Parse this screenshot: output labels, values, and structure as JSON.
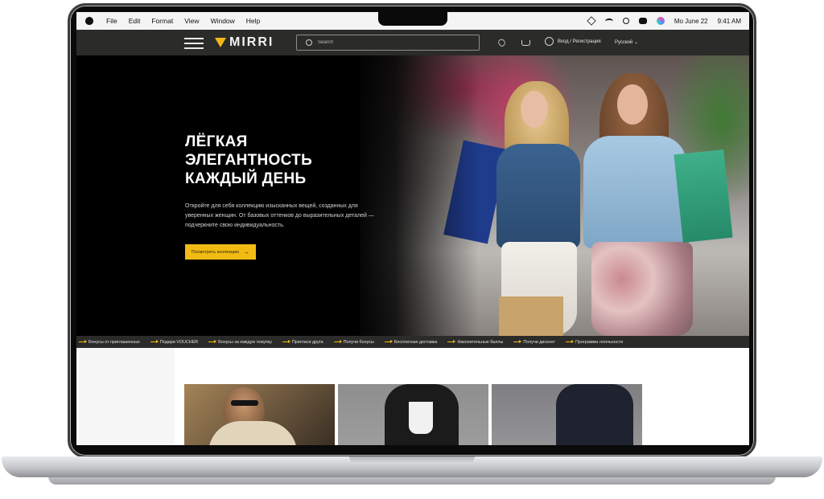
{
  "menubar": {
    "items": [
      "File",
      "Edit",
      "Format",
      "View",
      "Window",
      "Help"
    ],
    "date": "Mo June 22",
    "time": "9:41 AM"
  },
  "header": {
    "logo_text": "MIRRI",
    "search_placeholder": "Search",
    "login_label": "Вход / Регистрация",
    "language": "Русский",
    "language_caret": "⌄"
  },
  "hero": {
    "title_lines": [
      "ЛЁГКАЯ",
      "ЭЛЕГАНТНОСТЬ",
      "КАЖДЫЙ ДЕНЬ"
    ],
    "text": "Откройте для себя коллекцию изысканных вещей, созданных для уверенных женщин. От базовых оттенков до выразительных деталей — подчеркните свою индивидуальность.",
    "cta_label": "Посмотреть коллекцию",
    "cta_arrow": "→"
  },
  "benefits": [
    "Бонусы от приглашенных",
    "Подари VOUCHER",
    "Бонусы за каждую покупку",
    "Пригласи друга",
    "Получи бонусы",
    "Бесплатная доставка",
    "Накопительные баллы",
    "Получи дисконт",
    "Программа лояльности"
  ],
  "colors": {
    "accent": "#f2bb13",
    "header_bg": "#2b2b29",
    "hero_bg": "#000000"
  },
  "icons": {
    "menu": "hamburger-icon",
    "search": "search-icon",
    "favorites": "heart-icon",
    "cart": "cart-icon",
    "account": "user-icon"
  }
}
